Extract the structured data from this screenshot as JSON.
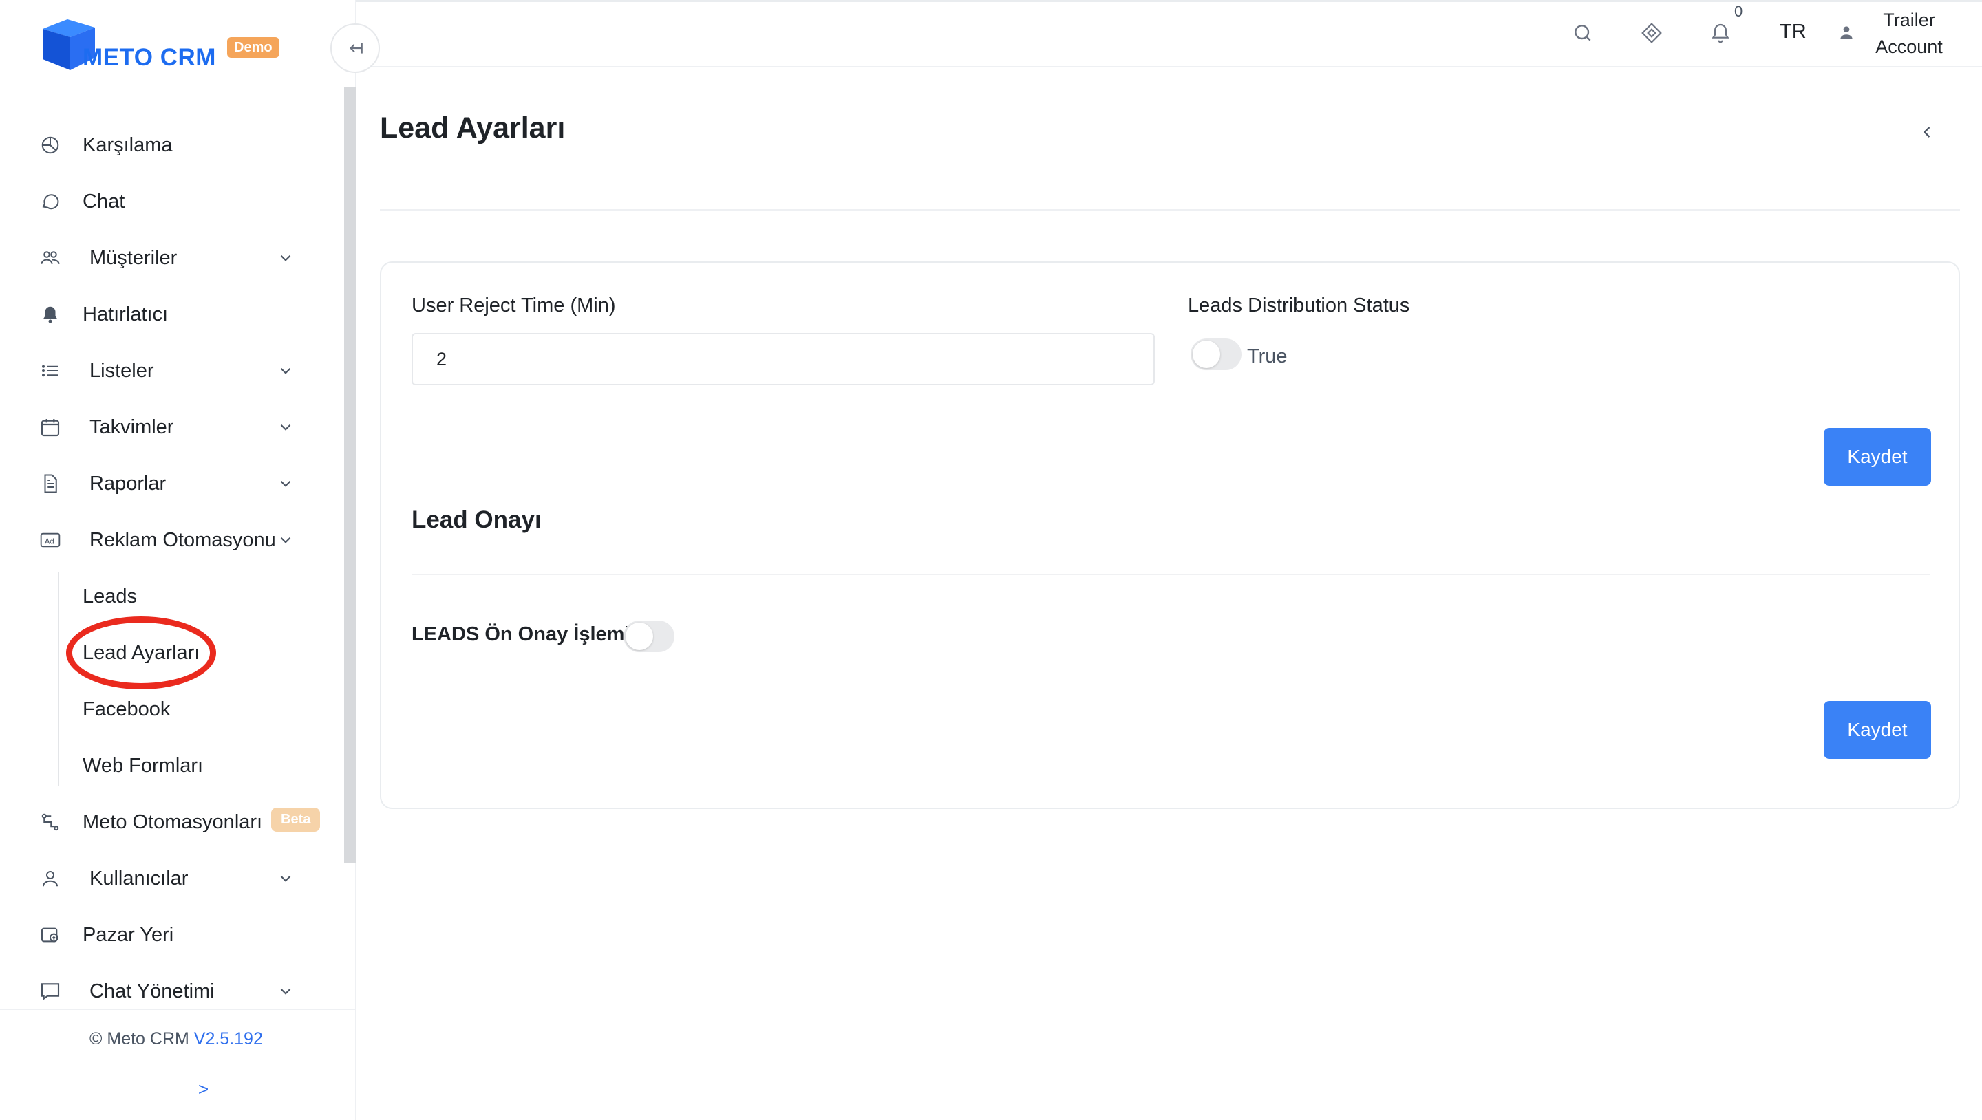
{
  "app": {
    "logo_text": "METO CRM",
    "logo_badge": "Demo",
    "brand_color": "#1d6cf0",
    "accent_color": "#3a82f6",
    "highlight_color": "#ea2a1e"
  },
  "header": {
    "notification_count": "0",
    "language": "TR",
    "account_label": "Trailer Account",
    "icons": [
      "search-icon",
      "diamond-icon",
      "bell-icon",
      "user-icon"
    ]
  },
  "sidebar": {
    "items": [
      {
        "label": "Karşılama",
        "icon": "pie-chart-icon"
      },
      {
        "label": "Chat",
        "icon": "chat-bubble-icon"
      },
      {
        "label": "Müşteriler",
        "icon": "users-icon",
        "expandable": true
      },
      {
        "label": "Hatırlatıcı",
        "icon": "bell-icon"
      },
      {
        "label": "Listeler",
        "icon": "list-icon",
        "expandable": true
      },
      {
        "label": "Takvimler",
        "icon": "calendar-icon",
        "expandable": true
      },
      {
        "label": "Raporlar",
        "icon": "document-icon",
        "expandable": true
      },
      {
        "label": "Reklam Otomasyonu",
        "icon": "ad-icon",
        "expandable": true,
        "expanded": true
      },
      {
        "label": "Meto Otomasyonları",
        "icon": "flow-icon",
        "badge": "Beta"
      },
      {
        "label": "Kullanıcılar",
        "icon": "user-icon",
        "expandable": true
      },
      {
        "label": "Pazar Yeri",
        "icon": "marketplace-icon"
      },
      {
        "label": "Chat Yönetimi",
        "icon": "message-square-icon",
        "expandable": true
      }
    ],
    "sub_items": [
      {
        "label": "Leads"
      },
      {
        "label": "Lead Ayarları",
        "active": true
      },
      {
        "label": "Facebook"
      },
      {
        "label": "Web Formları"
      }
    ],
    "footer": {
      "copyright": "© Meto CRM",
      "version": "V2.5.192",
      "expand_glyph": ">"
    }
  },
  "main": {
    "title": "Lead Ayarları",
    "card": {
      "reject_time_label": "User Reject Time (Min)",
      "reject_time_value": "2",
      "distribution_label": "Leads Distribution Status",
      "distribution_toggle_text": "True",
      "save_label": "Kaydet",
      "section_title": "Lead Onayı",
      "pre_approval_label": "LEADS Ön Onay İşlemi",
      "save_label_2": "Kaydet"
    }
  }
}
